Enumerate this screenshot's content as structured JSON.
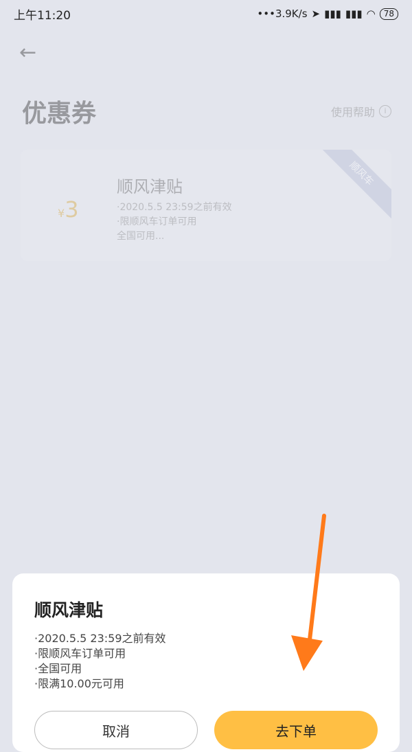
{
  "status_bar": {
    "time": "上午11:20",
    "network_speed": "•••3.9K/s",
    "battery": "78"
  },
  "page": {
    "title": "优惠券",
    "help_label": "使用帮助",
    "coupon": {
      "currency": "¥",
      "amount": "3",
      "name": "顺风津贴",
      "rules": [
        "·2020.5.5 23:59之前有效",
        "·限顺风车订单可用",
        "全国可用..."
      ],
      "tag": "顺风车"
    }
  },
  "sheet": {
    "title": "顺风津贴",
    "rules": [
      "·2020.5.5 23:59之前有效",
      "·限顺风车订单可用",
      "·全国可用",
      "·限满10.00元可用"
    ],
    "cancel_label": "取消",
    "order_label": "去下单"
  },
  "colors": {
    "accent": "#ffbf44",
    "arrow": "#ff7a1a",
    "amount": "#d8a93a"
  },
  "icons": {
    "back": "back-arrow-icon",
    "help": "info-circle-icon"
  }
}
